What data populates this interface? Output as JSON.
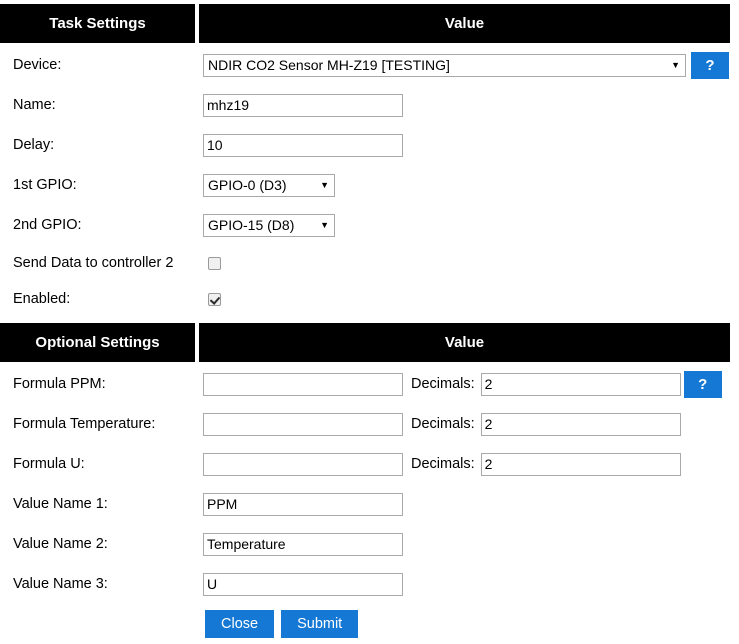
{
  "colors": {
    "header_bg": "#000000",
    "header_text": "#ffffff",
    "accent_blue": "#1478d4",
    "page_bg": "#ffffff",
    "input_border": "#a9a9a9"
  },
  "task_settings": {
    "header_left": "Task Settings",
    "header_right": "Value",
    "device": {
      "label": "Device:",
      "value": "NDIR CO2 Sensor MH-Z19 [TESTING]",
      "caret": "▼",
      "help": "?"
    },
    "name": {
      "label": "Name:",
      "value": "mhz19",
      "placeholder": ""
    },
    "delay": {
      "label": "Delay:",
      "value": "10",
      "placeholder": ""
    },
    "gpio1": {
      "label": "1st GPIO:",
      "value": "GPIO-0 (D3)",
      "caret": "▼"
    },
    "gpio2": {
      "label": "2nd GPIO:",
      "value": "GPIO-15 (D8)",
      "caret": "▼"
    },
    "send_data": {
      "label": "Send Data to controller 2",
      "checked": false
    },
    "enabled": {
      "label": "Enabled:",
      "checked": true
    }
  },
  "optional_settings": {
    "header_left": "Optional Settings",
    "header_right": "Value",
    "decimals_label": "Decimals:",
    "help": "?",
    "formulas": [
      {
        "label": "Formula PPM:",
        "formula_value": "",
        "formula_placeholder": "",
        "decimals_value": "2",
        "has_help": true
      },
      {
        "label": "Formula Temperature:",
        "formula_value": "",
        "formula_placeholder": "",
        "decimals_value": "2",
        "has_help": false
      },
      {
        "label": "Formula U:",
        "formula_value": "",
        "formula_placeholder": "",
        "decimals_value": "2",
        "has_help": false
      }
    ],
    "value_names": [
      {
        "label": "Value Name 1:",
        "value": "PPM",
        "placeholder": ""
      },
      {
        "label": "Value Name 2:",
        "value": "Temperature",
        "placeholder": ""
      },
      {
        "label": "Value Name 3:",
        "value": "U",
        "placeholder": ""
      }
    ]
  },
  "actions": {
    "close_label": "Close",
    "submit_label": "Submit"
  }
}
